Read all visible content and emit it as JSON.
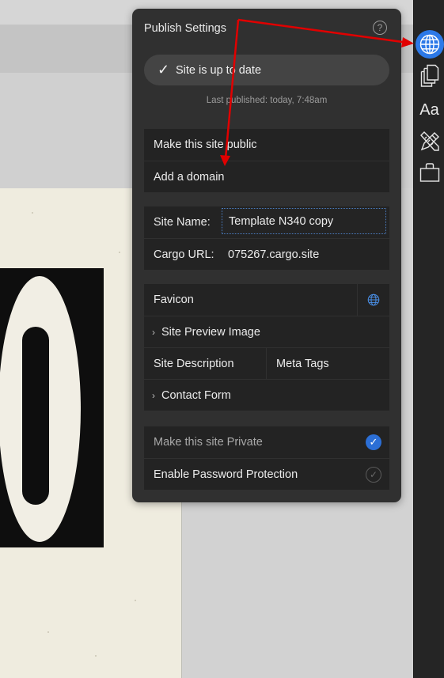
{
  "panel": {
    "title": "Publish Settings",
    "help_glyph": "?",
    "status": {
      "check_glyph": "✓",
      "text": "Site is up to date"
    },
    "last_published": "Last published: today, 7:48am"
  },
  "publish_actions": [
    {
      "label": "Make this site public"
    },
    {
      "label": "Add a domain"
    }
  ],
  "site_fields": {
    "name_label": "Site Name:",
    "name_value": "Template N340 copy",
    "url_label": "Cargo URL:",
    "url_value": "075267.cargo.site"
  },
  "meta_group": {
    "favicon": "Favicon",
    "preview_image": "Site Preview Image",
    "description": "Site Description",
    "meta_tags": "Meta Tags",
    "contact_form": "Contact Form",
    "chevron_glyph": "›"
  },
  "privacy": {
    "private_label": "Make this site Private",
    "private_checked": true,
    "password_label": "Enable Password Protection",
    "password_checked": false,
    "check_glyph": "✓"
  },
  "sidebar": {
    "icons": [
      "globe-icon",
      "pages-icon",
      "typography-icon",
      "design-tools-icon",
      "shop-bag-icon"
    ],
    "typography_label": "Aa",
    "active": "globe-icon"
  },
  "colors": {
    "accent": "#2c79e8",
    "annotation_arrow": "#e00000",
    "panel_bg": "#303030"
  },
  "icons": {
    "favicon_globe": "globe-icon"
  }
}
